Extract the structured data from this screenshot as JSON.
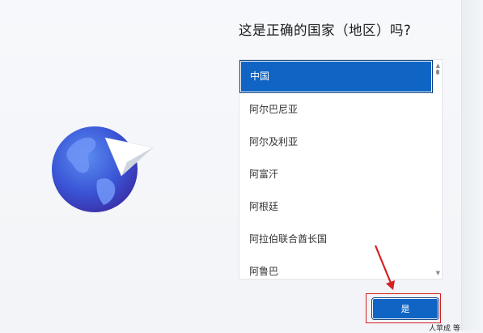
{
  "page": {
    "title": "这是正确的国家（地区）吗?"
  },
  "region_list": {
    "items": [
      "中国",
      "阿尔巴尼亚",
      "阿尔及利亚",
      "阿富汗",
      "阿根廷",
      "阿拉伯联合酋长国",
      "阿鲁巴"
    ],
    "selected_index": 0,
    "selected_value": "中国"
  },
  "actions": {
    "yes_label": "是"
  },
  "corner_text": "人苹成 等",
  "icons": {
    "illustration": "globe-with-paper-plane-icon",
    "scroll_up": "chevron-up-icon",
    "scroll_down": "chevron-down-icon",
    "annotation": "red-arrow-icon"
  },
  "colors": {
    "accent": "#1064c4",
    "annotation": "#d42020"
  }
}
